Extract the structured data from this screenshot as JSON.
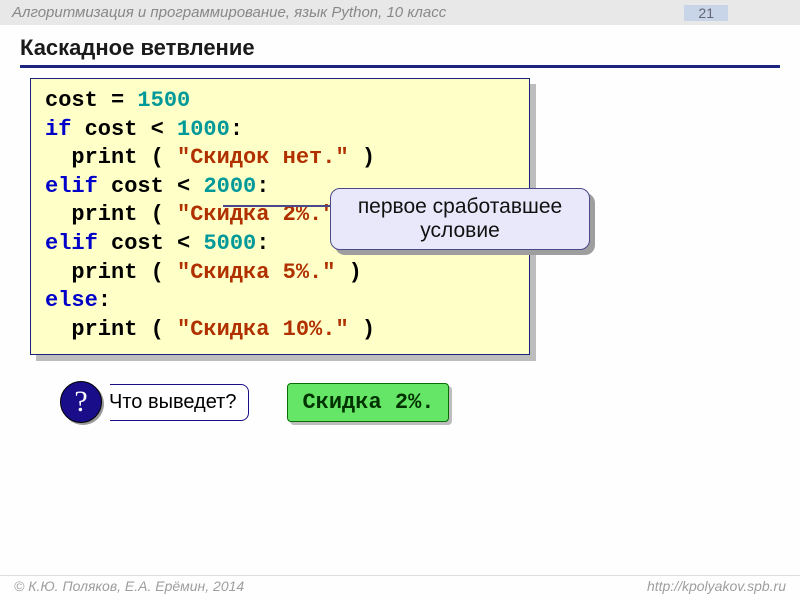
{
  "header": {
    "course": "Алгоритмизация и программирование, язык Python, 10 класс",
    "page_number": "21"
  },
  "title": "Каскадное ветвление",
  "code": {
    "l1_a": "cost = ",
    "l1_num": "1500",
    "l2_kw": "if",
    "l2_a": " cost < ",
    "l2_num": "1000",
    "l2_b": ":",
    "l3_a": "  print ( ",
    "l3_str": "\"Скидок нет.\"",
    "l3_b": " )",
    "l4_kw": "elif",
    "l4_a": " cost < ",
    "l4_num": "2000",
    "l4_b": ":",
    "l5_a": "  print ( ",
    "l5_str": "\"Скидка 2%.\"",
    "l5_b": " )",
    "l6_kw": "elif",
    "l6_a": " cost < ",
    "l6_num": "5000",
    "l6_b": ":",
    "l7_a": "  print ( ",
    "l7_str": "\"Скидка 5%.\"",
    "l7_b": " )",
    "l8_kw": "else",
    "l8_b": ":",
    "l9_a": "  print ( ",
    "l9_str": "\"Скидка 10%.\"",
    "l9_b": " )"
  },
  "callout": {
    "line1": "первое сработавшее",
    "line2": "условие"
  },
  "question": {
    "badge": "?",
    "label": "Что выведет?",
    "answer": "Скидка 2%."
  },
  "footer": {
    "authors": "© К.Ю. Поляков, Е.А. Ерёмин, 2014",
    "url": "http://kpolyakov.spb.ru"
  }
}
